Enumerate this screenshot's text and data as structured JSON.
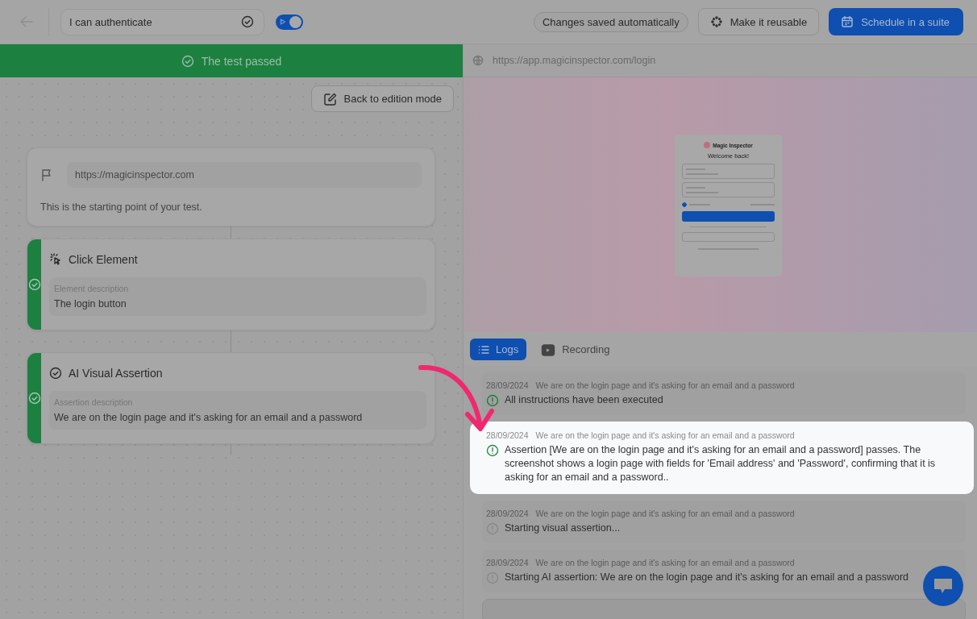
{
  "topbar": {
    "test_name": "I can authenticate",
    "run_toggle": {
      "on": true
    },
    "saved_badge": "Changes saved automatically",
    "buttons": [
      {
        "kind": "outline",
        "label": "Make it reusable"
      },
      {
        "kind": "primary",
        "label": "Schedule in a suite"
      }
    ]
  },
  "banner": {
    "passed": true,
    "text": "The test passed"
  },
  "edit_button": "Back to edition mode",
  "steps": [
    {
      "kind": "start",
      "url": "https://magicinspector.com",
      "note": "This is the starting point of your test."
    },
    {
      "kind": "click",
      "title": "Click Element",
      "field_label": "Element description",
      "value": "The login button",
      "passed": true
    },
    {
      "kind": "assertion",
      "title": "AI Visual Assertion",
      "field_label": "Assertion description",
      "value": "We are on the login page and it's asking for an email and a password",
      "passed": true
    }
  ],
  "preview": {
    "url": "https://app.magicinspector.com/login",
    "login": {
      "brand": "Magic Inspector",
      "heading": "Welcome back!"
    }
  },
  "tabs": [
    {
      "label": "Logs",
      "selected": true
    },
    {
      "label": "Recording",
      "selected": false
    }
  ],
  "logs": [
    {
      "date": "28/09/2024",
      "context": "We are on the login page and it's asking for an email and a password",
      "message": "All instructions have been executed",
      "success": true,
      "highlighted": false
    },
    {
      "date": "28/09/2024",
      "context": "We are on the login page and it's asking for an email and a password",
      "message": "Assertion [We are on the login page and it's asking for an email and a password] passes. The screenshot shows a login page with fields for 'Email address' and 'Password', confirming that it is asking for an email and a password..",
      "success": true,
      "highlighted": true
    },
    {
      "date": "28/09/2024",
      "context": "We are on the login page and it's asking for an email and a password",
      "message": "Starting visual assertion...",
      "success": false,
      "highlighted": false
    },
    {
      "date": "28/09/2024",
      "context": "We are on the login page and it's asking for an email and a password",
      "message": "Starting AI assertion: We are on the login page and it's asking for an email and a password",
      "success": false,
      "highlighted": false
    }
  ]
}
